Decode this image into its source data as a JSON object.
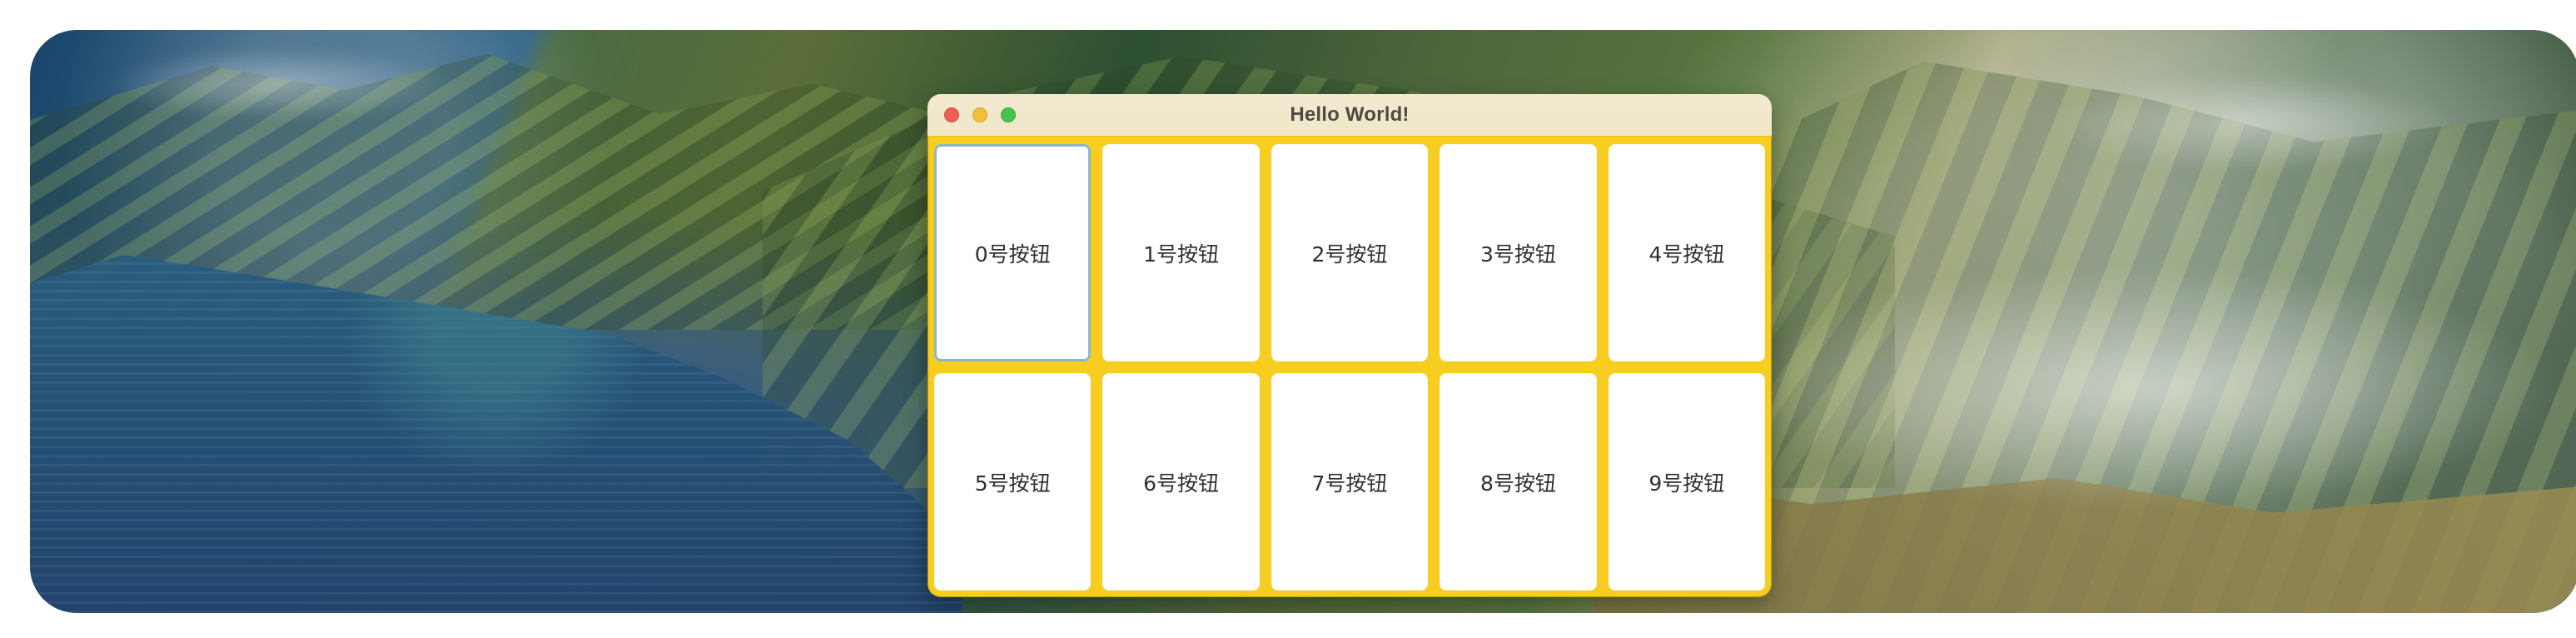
{
  "desktop": {
    "background": "coastal mountains wallpaper"
  },
  "window": {
    "title": "Hello World!",
    "controls": [
      {
        "name": "close",
        "color": "#EE5F57"
      },
      {
        "name": "minimize",
        "color": "#F4BE3C"
      },
      {
        "name": "zoom",
        "color": "#49C252"
      }
    ],
    "accent_color": "#F7CD1F"
  },
  "grid": {
    "buttons": [
      {
        "label": "0号按钮",
        "focused": true
      },
      {
        "label": "1号按钮",
        "focused": false
      },
      {
        "label": "2号按钮",
        "focused": false
      },
      {
        "label": "3号按钮",
        "focused": false
      },
      {
        "label": "4号按钮",
        "focused": false
      },
      {
        "label": "5号按钮",
        "focused": false
      },
      {
        "label": "6号按钮",
        "focused": false
      },
      {
        "label": "7号按钮",
        "focused": false
      },
      {
        "label": "8号按钮",
        "focused": false
      },
      {
        "label": "9号按钮",
        "focused": false
      }
    ]
  }
}
